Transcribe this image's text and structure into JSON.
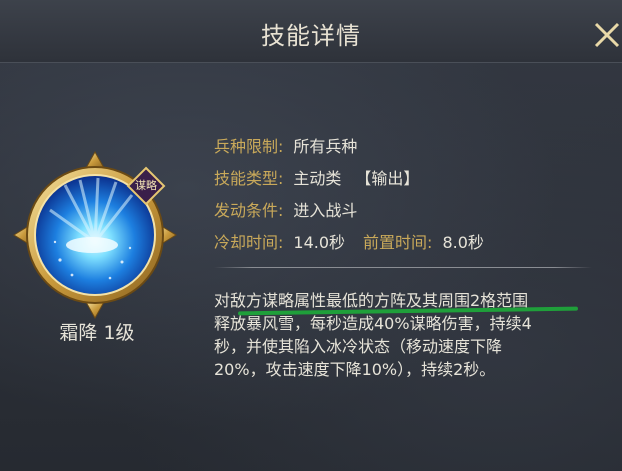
{
  "title": "技能详情",
  "skill": {
    "name": "霜降 1级",
    "badge": "谋略"
  },
  "info": {
    "troop_label": "兵种限制:",
    "troop_value": "所有兵种",
    "type_label": "技能类型:",
    "type_value": "主动类",
    "type_tag": "【输出】",
    "trigger_label": "发动条件:",
    "trigger_value": "进入战斗",
    "cooldown_label": "冷却时间:",
    "cooldown_value": "14.0秒",
    "prep_label": "前置时间:",
    "prep_value": "8.0秒"
  },
  "description": {
    "line1": "对敌方谋略属性最低的方阵及其周围2格范围",
    "line2": "释放暴风雪，每秒造成40%谋略伤害，持续4",
    "line3": "秒，并使其陷入冰冷状态（移动速度下降",
    "line4": "20%，攻击速度下降10%），持续2秒。"
  },
  "colors": {
    "label": "#c9a95a",
    "text": "#e6e3d8",
    "highlight": "#1f9f3a",
    "frame_gold": "#d9b860"
  }
}
